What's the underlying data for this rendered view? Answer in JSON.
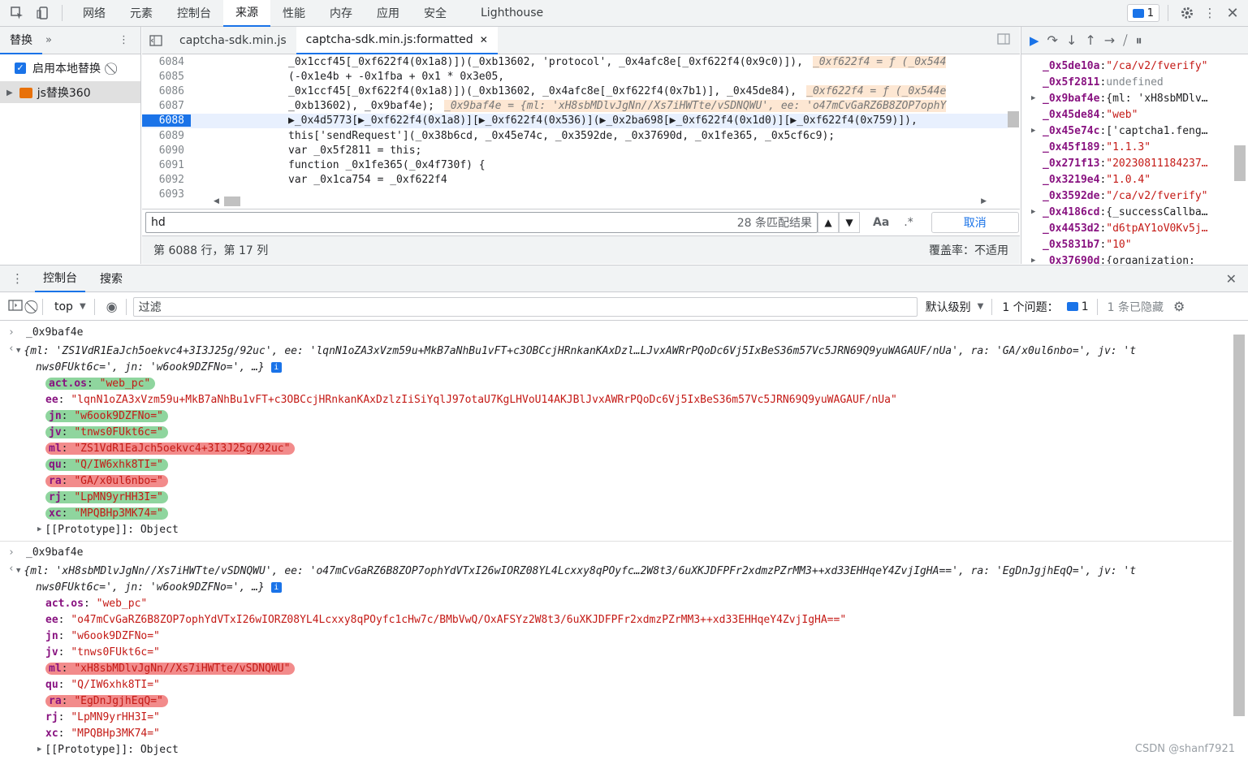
{
  "topbar": {
    "tabs": [
      "网络",
      "元素",
      "控制台",
      "来源",
      "性能",
      "内存",
      "应用",
      "安全",
      "Lighthouse"
    ],
    "active_tab": "来源",
    "issues_badge": "1"
  },
  "left": {
    "tab": "替换",
    "enable_label": "启用本地替换",
    "folder": "js替换360"
  },
  "editor": {
    "tabs": [
      "captcha-sdk.min.js",
      "captcha-sdk.min.js:formatted"
    ],
    "lines": [
      {
        "n": "6084",
        "code": "_0x1ccf45[_0xf622f4(0x1a8)])(_0xb13602, 'protocol', _0x4afc8e[_0xf622f4(0x9c0)]),",
        "insp": "_0xf622f4 = ƒ (_0x544"
      },
      {
        "n": "6085",
        "code": "(-0x1e4b + -0x1fba + 0x1 * 0x3e05,",
        "insp": ""
      },
      {
        "n": "6086",
        "code": "_0x1ccf45[_0xf622f4(0x1a8)])(_0xb13602, _0x4afc8e[_0xf622f4(0x7b1)], _0x45de84),",
        "insp": "_0xf622f4 = ƒ (_0x544e"
      },
      {
        "n": "6087",
        "code": "_0xb13602), _0x9baf4e);",
        "insp": "_0x9baf4e = {ml: 'xH8sbMDlvJgNn//Xs7iHWTte/vSDNQWU', ee: 'o47mCvGaRZ6B8ZOP7ophY"
      },
      {
        "n": "6088",
        "code": "▶_0x4d5773[▶_0xf622f4(0x1a8)][▶_0xf622f4(0x536)](▶_0x2ba698[▶_0xf622f4(0x1d0)][▶_0xf622f4(0x759)]),",
        "insp": ""
      },
      {
        "n": "6089",
        "code": "this['sendRequest'](_0x38b6cd, _0x45e74c, _0x3592de, _0x37690d, _0x1fe365, _0x5cf6c9);",
        "insp": ""
      },
      {
        "n": "6090",
        "code": "var _0x5f2811 = this;",
        "insp": ""
      },
      {
        "n": "6091",
        "code": "function _0x1fe365(_0x4f730f) {",
        "insp": ""
      },
      {
        "n": "6092",
        "code": "    var _0x1ca754 = _0xf622f4",
        "insp": ""
      },
      {
        "n": "6093",
        "code": "",
        "insp": ""
      }
    ],
    "current_line": "6088",
    "search_value": "hd",
    "match_count": "28 条匹配结果",
    "case_btn": "Aa",
    "regex_btn": ".*",
    "cancel": "取消",
    "status_pos": "第 6088 行，第 17 列",
    "coverage": "覆盖率：不适用"
  },
  "scope": [
    {
      "key": "_0x5de10a",
      "val": "\"/ca/v2/fverify\"",
      "kind": "str",
      "arrow": false
    },
    {
      "key": "_0x5f2811",
      "val": "undefined",
      "kind": "undef",
      "arrow": false
    },
    {
      "key": "_0x9baf4e",
      "val": "{ml: 'xH8sbMDlv…",
      "kind": "obj",
      "arrow": true
    },
    {
      "key": "_0x45de84",
      "val": "\"web\"",
      "kind": "str",
      "arrow": false
    },
    {
      "key": "_0x45e74c",
      "val": "['captcha1.feng…",
      "kind": "obj",
      "arrow": true
    },
    {
      "key": "_0x45f189",
      "val": "\"1.1.3\"",
      "kind": "str",
      "arrow": false
    },
    {
      "key": "_0x271f13",
      "val": "\"20230811184237…",
      "kind": "str",
      "arrow": false
    },
    {
      "key": "_0x3219e4",
      "val": "\"1.0.4\"",
      "kind": "str",
      "arrow": false
    },
    {
      "key": "_0x3592de",
      "val": "\"/ca/v2/fverify\"",
      "kind": "str",
      "arrow": false
    },
    {
      "key": "_0x4186cd",
      "val": "{_successCallba…",
      "kind": "obj",
      "arrow": true
    },
    {
      "key": "_0x4453d2",
      "val": "\"d6tpAY1oV0Kv5j…",
      "kind": "str",
      "arrow": false
    },
    {
      "key": "_0x5831b7",
      "val": "\"10\"",
      "kind": "str",
      "arrow": false
    },
    {
      "key": "_0x37690d",
      "val": "{organization:",
      "kind": "obj",
      "arrow": true
    }
  ],
  "drawer": {
    "tabs": [
      "控制台",
      "搜索"
    ],
    "context": "top",
    "filter_placeholder": "过滤",
    "level": "默认级别",
    "issues": "1 个问题：",
    "issues_count": "1",
    "hidden": "1 条已隐藏"
  },
  "console": {
    "entry1": {
      "input": "_0x9baf4e",
      "summary1": "{ml: 'ZS1VdR1EaJch5oekvc4+3I3J25g/92uc', ee: 'lqnN1oZA3xVzm59u+MkB7aNhBu1vFT+c3OBCcjHRnkanKAxDzl…LJvxAWRrPQoDc6Vj5IxBeS36m57Vc5JRN69Q9yuWAGAUF/nUa', ra: 'GA/x0ul6nbo=', jv: 't",
      "summary2": "nws0FUkt6c=', jn: 'w6ook9DZFNo=', …}",
      "props": [
        {
          "k": "act.os",
          "v": "\"web_pc\"",
          "hl": "green"
        },
        {
          "k": "ee",
          "v": "\"lqnN1oZA3xVzm59u+MkB7aNhBu1vFT+c3OBCcjHRnkanKAxDzlzIiSiYqlJ97otaU7KgLHVoU14AKJBlJvxAWRrPQoDc6Vj5IxBeS36m57Vc5JRN69Q9yuWAGAUF/nUa\"",
          "hl": ""
        },
        {
          "k": "jn",
          "v": "\"w6ook9DZFNo=\"",
          "hl": "green"
        },
        {
          "k": "jv",
          "v": "\"tnws0FUkt6c=\"",
          "hl": "green"
        },
        {
          "k": "ml",
          "v": "\"ZS1VdR1EaJch5oekvc4+3I3J25g/92uc\"",
          "hl": "red"
        },
        {
          "k": "qu",
          "v": "\"Q/IW6xhk8TI=\"",
          "hl": "green"
        },
        {
          "k": "ra",
          "v": "\"GA/x0ul6nbo=\"",
          "hl": "red"
        },
        {
          "k": "rj",
          "v": "\"LpMN9yrHH3I=\"",
          "hl": "green"
        },
        {
          "k": "xc",
          "v": "\"MPQBHp3MK74=\"",
          "hl": "green"
        }
      ],
      "proto": "[[Prototype]]: Object"
    },
    "entry2": {
      "input": "_0x9baf4e",
      "summary1": "{ml: 'xH8sbMDlvJgNn//Xs7iHWTte/vSDNQWU', ee: 'o47mCvGaRZ6B8ZOP7ophYdVTxI26wIORZ08YL4Lcxxy8qPOyfc…2W8t3/6uXKJDFPFr2xdmzPZrMM3++xd33EHHqeY4ZvjIgHA==', ra: 'EgDnJgjhEqQ=', jv: 't",
      "summary2": "nws0FUkt6c=', jn: 'w6ook9DZFNo=', …}",
      "props": [
        {
          "k": "act.os",
          "v": "\"web_pc\"",
          "hl": ""
        },
        {
          "k": "ee",
          "v": "\"o47mCvGaRZ6B8ZOP7ophYdVTxI26wIORZ08YL4Lcxxy8qPOyfc1cHw7c/BMbVwQ/OxAFSYz2W8t3/6uXKJDFPFr2xdmzPZrMM3++xd33EHHqeY4ZvjIgHA==\"",
          "hl": ""
        },
        {
          "k": "jn",
          "v": "\"w6ook9DZFNo=\"",
          "hl": ""
        },
        {
          "k": "jv",
          "v": "\"tnws0FUkt6c=\"",
          "hl": ""
        },
        {
          "k": "ml",
          "v": "\"xH8sbMDlvJgNn//Xs7iHWTte/vSDNQWU\"",
          "hl": "red"
        },
        {
          "k": "qu",
          "v": "\"Q/IW6xhk8TI=\"",
          "hl": ""
        },
        {
          "k": "ra",
          "v": "\"EgDnJgjhEqQ=\"",
          "hl": "red"
        },
        {
          "k": "rj",
          "v": "\"LpMN9yrHH3I=\"",
          "hl": ""
        },
        {
          "k": "xc",
          "v": "\"MPQBHp3MK74=\"",
          "hl": ""
        }
      ],
      "proto": "[[Prototype]]: Object"
    }
  },
  "watermark": "CSDN @shanf7921"
}
